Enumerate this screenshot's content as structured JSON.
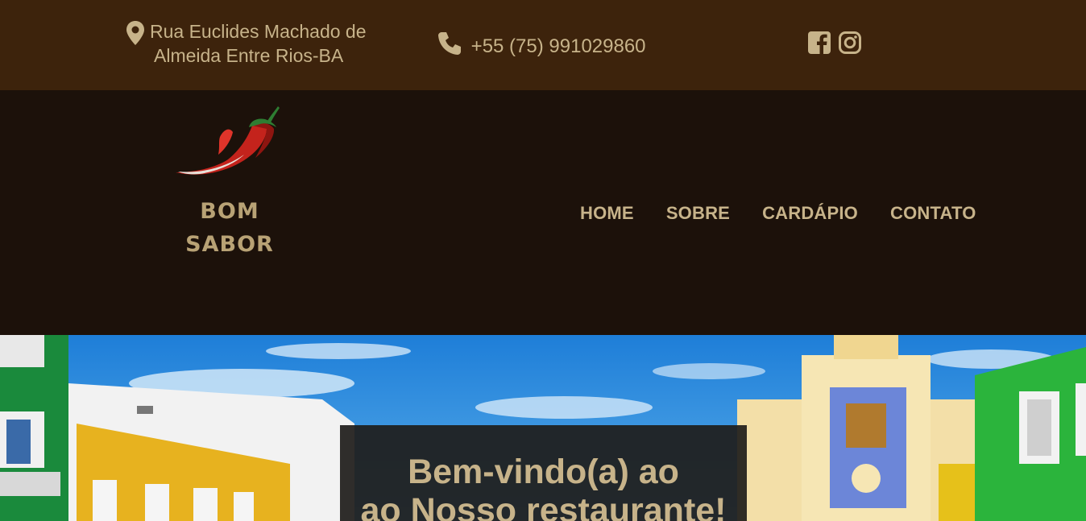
{
  "topbar": {
    "address_line1": "Rua Euclides Machado de",
    "address_line2": "Almeida Entre Rios-BA",
    "phone": "+55 (75) 991029860",
    "icons": {
      "location": "map-pin-icon",
      "phone": "phone-icon",
      "facebook": "facebook-icon",
      "instagram": "instagram-icon"
    }
  },
  "logo": {
    "line1": "BOM",
    "line2": "SABOR",
    "icon": "chili-pepper-icon"
  },
  "nav": {
    "items": [
      {
        "label": "HOME"
      },
      {
        "label": "SOBRE"
      },
      {
        "label": "CARDÁPIO"
      },
      {
        "label": "CONTATO"
      }
    ]
  },
  "hero": {
    "title_line1": "Bem-vindo(a) ao",
    "title_line2": "ao Nosso restaurante!"
  },
  "colors": {
    "topbar": "#3d230c",
    "header": "#1c110a",
    "accent_text": "#c7b38a"
  }
}
